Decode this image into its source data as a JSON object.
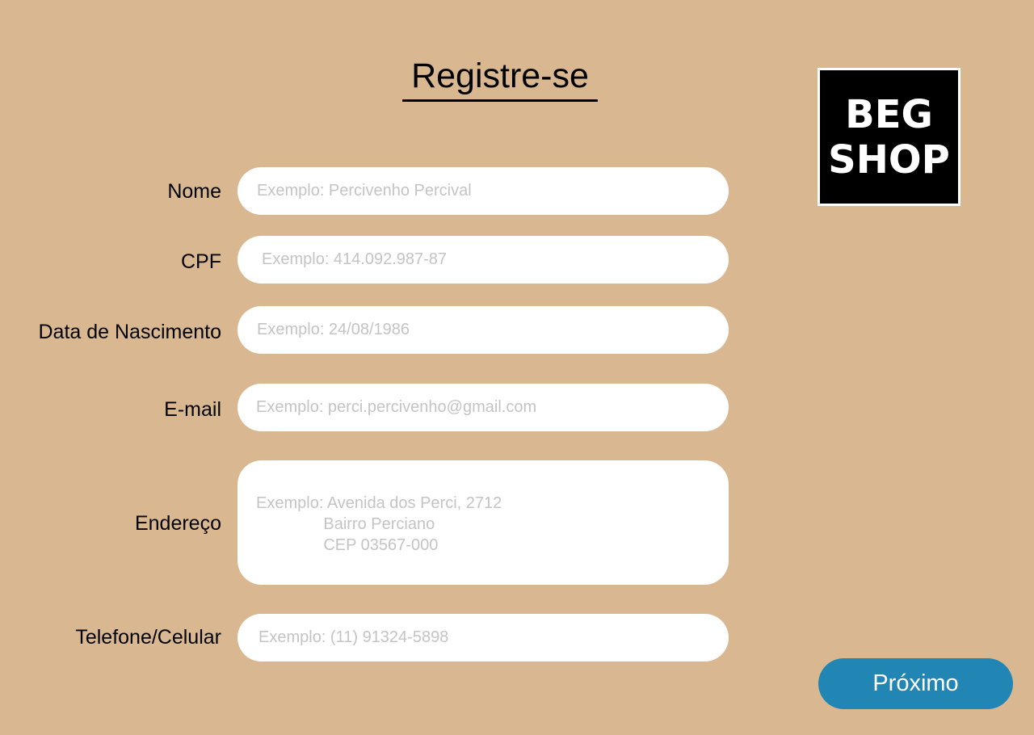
{
  "page": {
    "title": "Registre-se"
  },
  "logo": {
    "line1": "BEG",
    "line2": "SHOP"
  },
  "form": {
    "fields": [
      {
        "label": "Nome",
        "value": "",
        "placeholder": "Exemplo: Percivenho Percival"
      },
      {
        "label": "CPF",
        "value": "",
        "placeholder": "Exemplo: 414.092.987-87"
      },
      {
        "label": "Data de Nascimento",
        "value": "",
        "placeholder": "Exemplo: 24/08/1986"
      },
      {
        "label": "E-mail",
        "value": "",
        "placeholder": "Exemplo: perci.percivenho@gmail.com"
      },
      {
        "label": "Endereço",
        "value": "",
        "placeholder": "Exemplo: Avenida dos Perci, 2712\n               Bairro Perciano\n               CEP 03567-000"
      },
      {
        "label": "Telefone/Celular",
        "value": "",
        "placeholder": "Exemplo: (11) 91324-5898"
      }
    ]
  },
  "actions": {
    "next_label": "Próximo"
  },
  "colors": {
    "background": "#d9b891",
    "button": "#2186b4",
    "placeholder": "#c4c4c4",
    "logo_bg": "#000000"
  }
}
